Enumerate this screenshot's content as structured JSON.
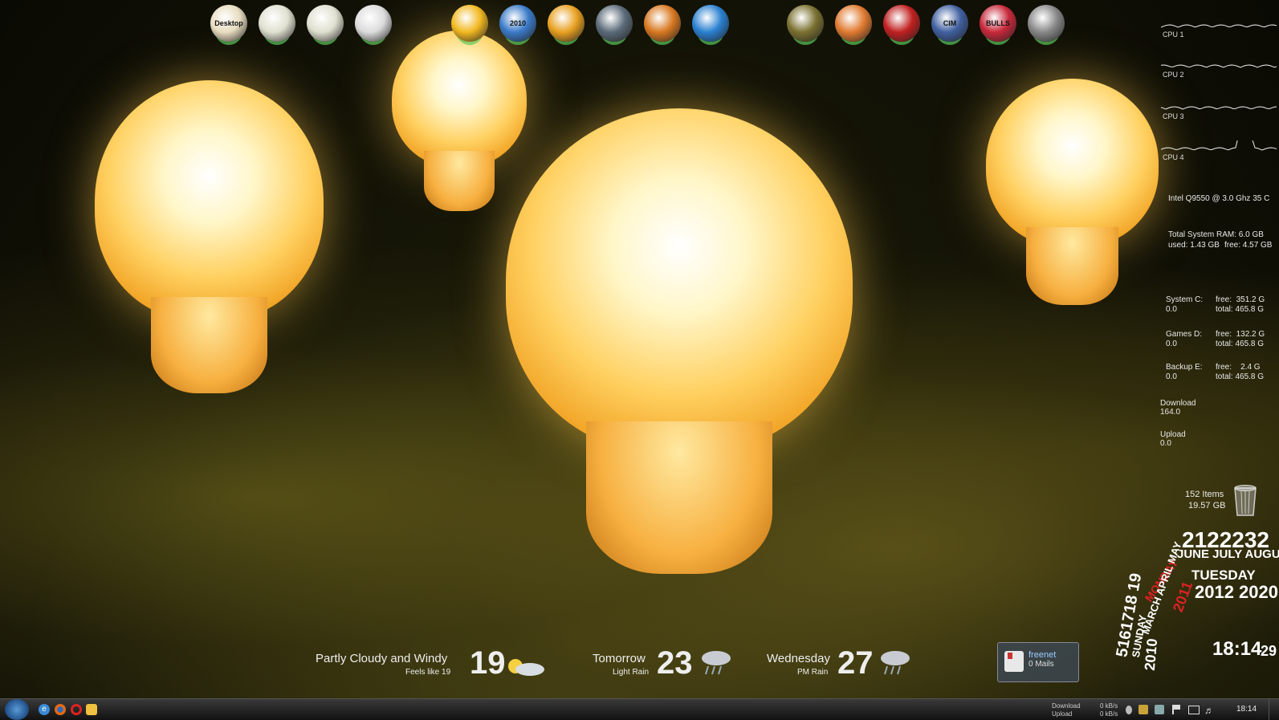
{
  "dock": {
    "left_group": [
      {
        "name": "desktop-folder-icon",
        "label": "Desktop"
      },
      {
        "name": "drive-c-icon",
        "label": ""
      },
      {
        "name": "drive-d-icon",
        "label": ""
      },
      {
        "name": "drive-e-icon",
        "label": ""
      }
    ],
    "center_group": [
      {
        "name": "puzzle-app-icon",
        "label": ""
      },
      {
        "name": "thunderbird-2010-icon",
        "label": "2010"
      },
      {
        "name": "aimp-icon",
        "label": ""
      },
      {
        "name": "speaker-icon",
        "label": ""
      },
      {
        "name": "media-center-icon",
        "label": ""
      },
      {
        "name": "itunes-icon",
        "label": ""
      }
    ],
    "right_group": [
      {
        "name": "computer-game-icon",
        "label": ""
      },
      {
        "name": "notebook-icon",
        "label": ""
      },
      {
        "name": "r-logo-icon",
        "label": ""
      },
      {
        "name": "cim-truck-icon",
        "label": "CIM"
      },
      {
        "name": "bulls-player-icon",
        "label": "BULLS"
      },
      {
        "name": "steam-icon",
        "label": ""
      }
    ]
  },
  "cpu_meters": [
    "CPU 1",
    "CPU 2",
    "CPU 3",
    "CPU 4"
  ],
  "system": {
    "cpu_info": "Intel Q9550 @ 3.0 Ghz 35 C",
    "ram_title": "Total System RAM:  6.0 GB",
    "ram_used": "used: 1.43 GB",
    "ram_free": "free: 4.57 GB",
    "drives": [
      {
        "name": "System C:",
        "val": "0.0",
        "free": "free:  351.2 G",
        "total": "total: 465.8 G"
      },
      {
        "name": "Games D:",
        "val": "0.0",
        "free": "free:  132.2 G",
        "total": "total: 465.8 G"
      },
      {
        "name": "Backup E:",
        "val": "0.0",
        "free": "free:    2.4 G",
        "total": "total: 465.8 G"
      }
    ],
    "download_label": "Download",
    "download_val": "164.0",
    "upload_label": "Upload",
    "upload_val": "0.0"
  },
  "recycle": {
    "items": "152 Items",
    "size": "19.57 GB"
  },
  "weather": {
    "today_cond": "Partly Cloudy  and  Windy",
    "today_feels": "Feels like 19",
    "today_temp": "19",
    "tomorrow_label": "Tomorrow",
    "tomorrow_cond": "Light Rain",
    "tomorrow_temp": "23",
    "wed_label": "Wednesday",
    "wed_cond": "PM Rain",
    "wed_temp": "27"
  },
  "mail": {
    "provider": "freenet",
    "count": "0 Mails"
  },
  "clock": {
    "time": "18:14",
    "seconds": "29"
  },
  "calendar": {
    "days": "2122232",
    "months": "JUNE JULY AUGUST",
    "day_name": "TUESDAY",
    "years": "2012 2020",
    "left_months": "MARCH APRIL MAY",
    "left_days": "5161718 19",
    "left_year": "2010",
    "monday": "MONDAY",
    "sunday": "SUNDAY",
    "year_red": "2011"
  },
  "taskbar": {
    "download_label": "Download",
    "upload_label": "Upload",
    "down_rate": "0 kB/s",
    "up_rate": "0 kB/s",
    "time": "18:14"
  }
}
